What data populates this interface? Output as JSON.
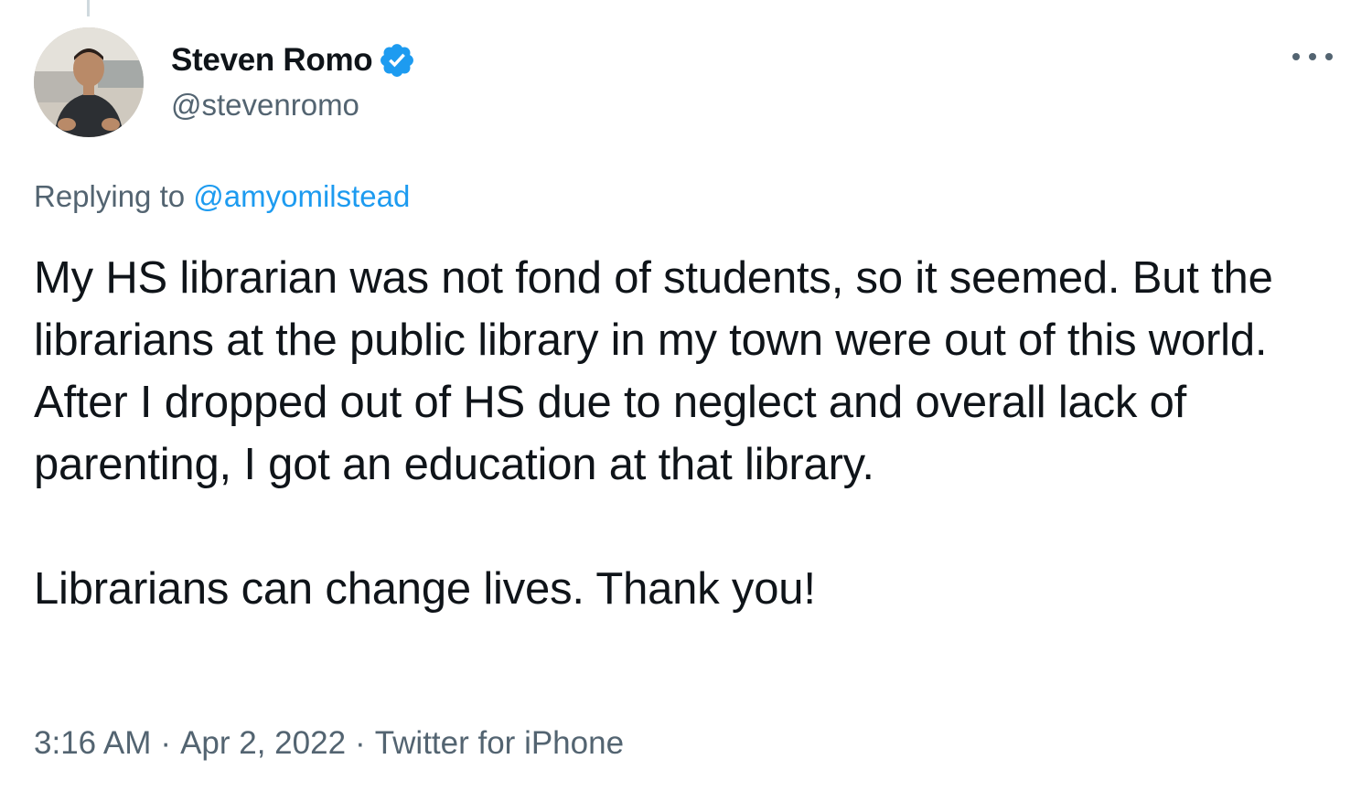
{
  "author": {
    "display_name": "Steven Romo",
    "handle": "@stevenromo",
    "verified": true,
    "verified_color": "#1d9bf0"
  },
  "menu": {
    "icon": "more-horizontal-icon"
  },
  "reply": {
    "prefix": "Replying to",
    "mention": "@amyomilstead",
    "mention_color": "#1d9bf0"
  },
  "tweet": {
    "paragraph_1": "My HS librarian was not fond of students, so it seemed. But the librarians at the public library in my town were out of this world. After I dropped out of HS due to neglect and overall lack of parenting, I got an education at that library.",
    "paragraph_2": "Librarians can change lives. Thank you!"
  },
  "meta": {
    "time": "3:16 AM",
    "separator": "·",
    "date": "Apr 2, 2022",
    "source": "Twitter for iPhone"
  },
  "colors": {
    "text_primary": "#0f1419",
    "text_secondary": "#536471",
    "background": "#ffffff"
  }
}
